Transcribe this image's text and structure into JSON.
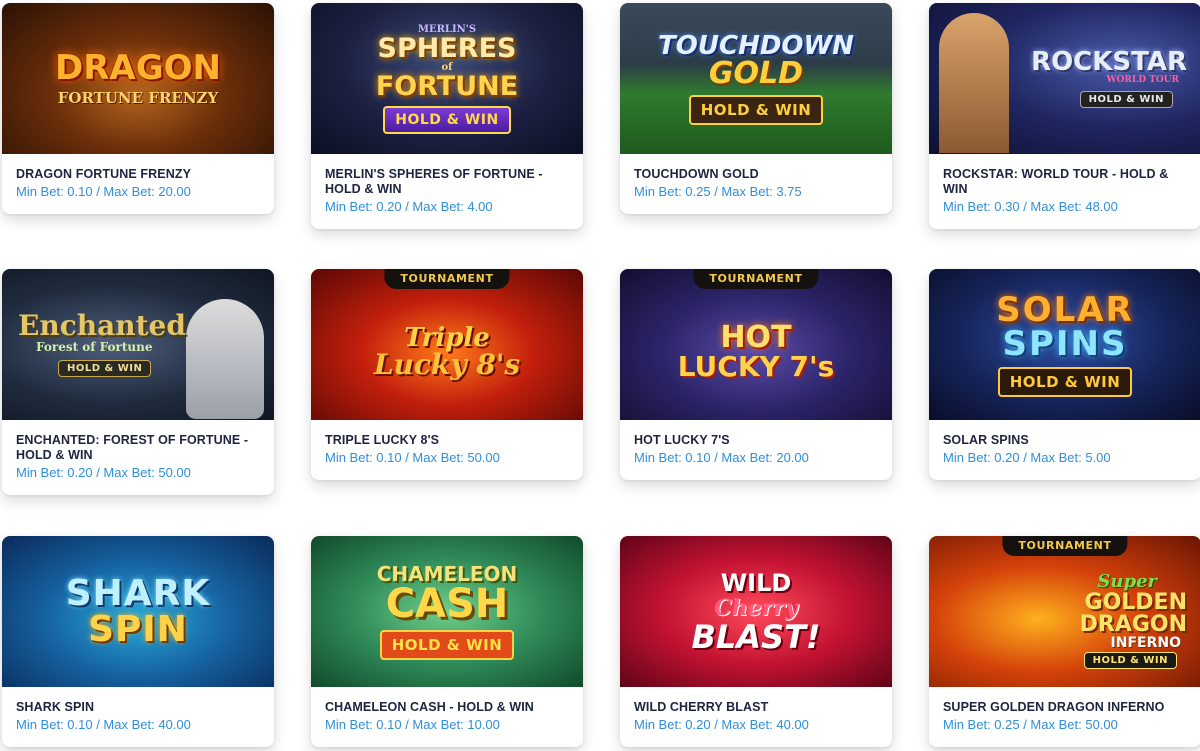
{
  "games": [
    {
      "title": "DRAGON FORTUNE FRENZY",
      "bets": "Min Bet: 0.10 / Max Bet: 20.00",
      "logo": [
        "DRAGON",
        "FORTUNE FRENZY"
      ],
      "badge": "",
      "tournament": ""
    },
    {
      "title": "MERLIN'S SPHERES OF FORTUNE - HOLD & WIN",
      "bets": "Min Bet: 0.20 / Max Bet: 4.00",
      "logo": [
        "MERLIN'S",
        "SPHERES",
        "of",
        "FORTUNE"
      ],
      "badge": "HOLD & WIN",
      "tournament": ""
    },
    {
      "title": "TOUCHDOWN GOLD",
      "bets": "Min Bet: 0.25 / Max Bet: 3.75",
      "logo": [
        "TOUCHDOWN",
        "GOLD"
      ],
      "badge": "HOLD & WIN",
      "tournament": ""
    },
    {
      "title": "ROCKSTAR: WORLD TOUR - HOLD & WIN",
      "bets": "Min Bet: 0.30 / Max Bet: 48.00",
      "logo": [
        "ROCKSTAR",
        "WORLD TOUR"
      ],
      "badge": "HOLD & WIN",
      "tournament": ""
    },
    {
      "title": "ENCHANTED: FOREST OF FORTUNE - HOLD & WIN",
      "bets": "Min Bet: 0.20 / Max Bet: 50.00",
      "logo": [
        "Enchanted",
        "Forest of Fortune"
      ],
      "badge": "HOLD & WIN",
      "tournament": ""
    },
    {
      "title": "TRIPLE LUCKY 8'S",
      "bets": "Min Bet: 0.10 / Max Bet: 50.00",
      "logo": [
        "Triple",
        "Lucky 8's"
      ],
      "badge": "",
      "tournament": "TOURNAMENT"
    },
    {
      "title": "HOT LUCKY 7'S",
      "bets": "Min Bet: 0.10 / Max Bet: 20.00",
      "logo": [
        "HOT",
        "LUCKY 7's"
      ],
      "badge": "",
      "tournament": "TOURNAMENT"
    },
    {
      "title": "SOLAR SPINS",
      "bets": "Min Bet: 0.20 / Max Bet: 5.00",
      "logo": [
        "SOLAR",
        "SPINS"
      ],
      "badge": "HOLD & WIN",
      "tournament": ""
    },
    {
      "title": "SHARK SPIN",
      "bets": "Min Bet: 0.10 / Max Bet: 40.00",
      "logo": [
        "SHARK",
        "SPIN"
      ],
      "badge": "",
      "tournament": ""
    },
    {
      "title": "CHAMELEON CASH - HOLD & WIN",
      "bets": "Min Bet: 0.10 / Max Bet: 10.00",
      "logo": [
        "CHAMELEON",
        "CASH"
      ],
      "badge": "HOLD & WIN",
      "tournament": ""
    },
    {
      "title": "WILD CHERRY BLAST",
      "bets": "Min Bet: 0.20 / Max Bet: 40.00",
      "logo": [
        "WILD",
        "Cherry",
        "BLAST!"
      ],
      "badge": "",
      "tournament": ""
    },
    {
      "title": "SUPER GOLDEN DRAGON INFERNO",
      "bets": "Min Bet: 0.25 / Max Bet: 50.00",
      "logo": [
        "Super",
        "GOLDEN",
        "DRAGON",
        "INFERNO"
      ],
      "badge": "HOLD & WIN",
      "tournament": "TOURNAMENT"
    }
  ],
  "colors": {
    "title": "#1e2440",
    "bets": "#2f8fd8",
    "card_bg": "#ffffff"
  }
}
